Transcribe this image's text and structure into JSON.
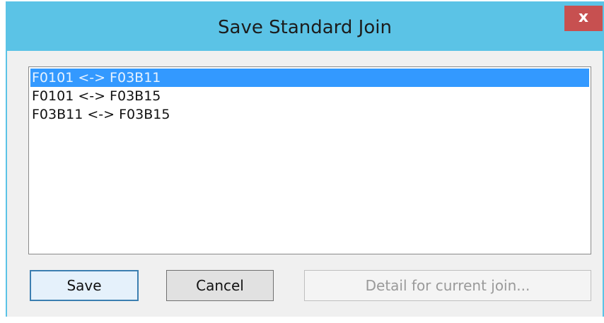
{
  "window": {
    "title": "Save Standard Join",
    "close_label": "x"
  },
  "joins": {
    "items": [
      {
        "label": "F0101 <-> F03B11",
        "selected": true
      },
      {
        "label": "F0101 <-> F03B15",
        "selected": false
      },
      {
        "label": "F03B11 <-> F03B15",
        "selected": false
      }
    ]
  },
  "buttons": {
    "save_label": "Save",
    "cancel_label": "Cancel",
    "detail_label": "Detail for current join..."
  },
  "colors": {
    "titlebar": "#5bc3e6",
    "close": "#c75050",
    "selection": "#3399ff"
  }
}
